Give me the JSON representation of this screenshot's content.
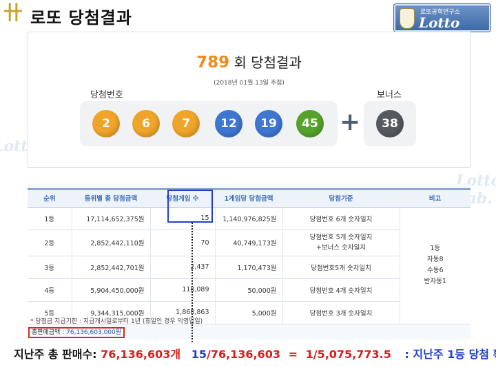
{
  "header": {
    "title": "로또 당첨결과",
    "logo_glyph": "卄"
  },
  "brand": {
    "subtitle": "로또공학연구소",
    "name": "Lotto Lab."
  },
  "watermark": "Lotto Lab.",
  "draw": {
    "number": "789",
    "title_suffix": "회 당첨결과",
    "date": "(2018년 01월 13일 추첨)"
  },
  "labels": {
    "win": "당첨번호",
    "bonus": "보너스",
    "plus": "+"
  },
  "balls": [
    {
      "value": "2",
      "color": "#f0a52a"
    },
    {
      "value": "6",
      "color": "#f0a52a"
    },
    {
      "value": "7",
      "color": "#f0a52a"
    },
    {
      "value": "12",
      "color": "#3e77d2"
    },
    {
      "value": "19",
      "color": "#3e77d2"
    },
    {
      "value": "45",
      "color": "#56a32b"
    }
  ],
  "bonus_ball": {
    "value": "38",
    "color": "#555a60"
  },
  "table": {
    "headers": [
      "순위",
      "등위별 총 당첨금액",
      "당첨게임 수",
      "1게임당 당첨금액",
      "당첨기준",
      "비고"
    ],
    "rows": [
      {
        "rank": "1등",
        "total": "17,114,652,375원",
        "games": "15",
        "per": "1,140,976,825원",
        "criteria": "당첨번호 6개 숫자일치"
      },
      {
        "rank": "2등",
        "total": "2,852,442,110원",
        "games": "70",
        "per": "40,749,173원",
        "criteria": "당첨번호 5개 숫자일치",
        "criteria2": "+보너스 숫자일치"
      },
      {
        "rank": "3등",
        "total": "2,852,442,701원",
        "games": "2,437",
        "per": "1,170,473원",
        "criteria": "당첨번호5개 숫자일치"
      },
      {
        "rank": "4등",
        "total": "5,904,450,000원",
        "games": "118,089",
        "per": "50,000원",
        "criteria": "당첨번호 4개 숫자일치"
      },
      {
        "rank": "5등",
        "total": "9,344,315,000원",
        "games": "1,868,863",
        "per": "5,000원",
        "criteria": "당첨번호 3개 숫자일치"
      }
    ],
    "remarks": [
      "1등",
      "자동8",
      "수동6",
      "반자동1"
    ]
  },
  "note": "* 당첨금 지급기한 : 지급개시일로부터 1년 (휴일인 경우 익영업일)",
  "total_sales": {
    "label": "총판매금액 :",
    "value": "76,136,603,000원"
  },
  "summary": {
    "label": "지난주 총 판매수:",
    "sales_count": "76,136,603개",
    "winners": "15",
    "slash_total": "/76,136,603",
    "equals": "=",
    "ratio": "1/5,075,773.5",
    "caption": ": 지난주 1등 당첨 확률"
  }
}
